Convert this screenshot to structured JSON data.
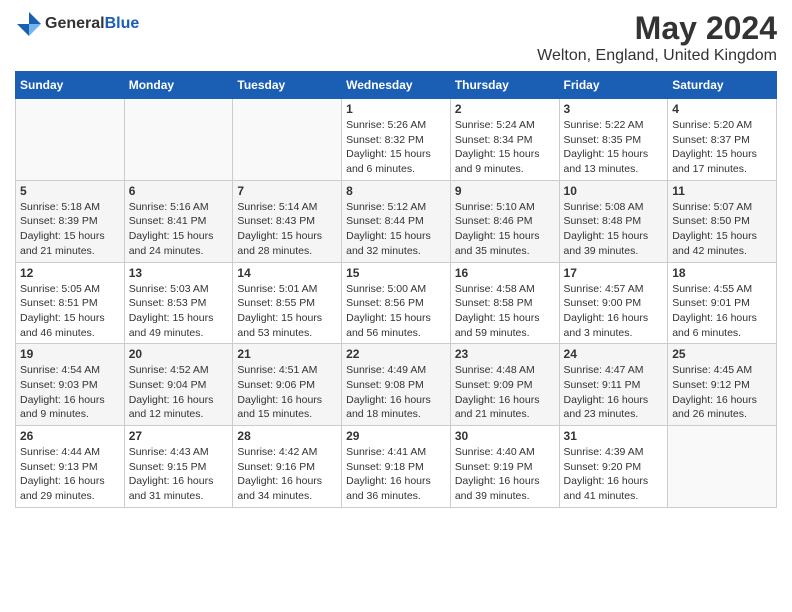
{
  "header": {
    "logo_general": "General",
    "logo_blue": "Blue",
    "month_title": "May 2024",
    "location": "Welton, England, United Kingdom"
  },
  "days_of_week": [
    "Sunday",
    "Monday",
    "Tuesday",
    "Wednesday",
    "Thursday",
    "Friday",
    "Saturday"
  ],
  "weeks": [
    [
      {
        "day": "",
        "info": ""
      },
      {
        "day": "",
        "info": ""
      },
      {
        "day": "",
        "info": ""
      },
      {
        "day": "1",
        "info": "Sunrise: 5:26 AM\nSunset: 8:32 PM\nDaylight: 15 hours\nand 6 minutes."
      },
      {
        "day": "2",
        "info": "Sunrise: 5:24 AM\nSunset: 8:34 PM\nDaylight: 15 hours\nand 9 minutes."
      },
      {
        "day": "3",
        "info": "Sunrise: 5:22 AM\nSunset: 8:35 PM\nDaylight: 15 hours\nand 13 minutes."
      },
      {
        "day": "4",
        "info": "Sunrise: 5:20 AM\nSunset: 8:37 PM\nDaylight: 15 hours\nand 17 minutes."
      }
    ],
    [
      {
        "day": "5",
        "info": "Sunrise: 5:18 AM\nSunset: 8:39 PM\nDaylight: 15 hours\nand 21 minutes."
      },
      {
        "day": "6",
        "info": "Sunrise: 5:16 AM\nSunset: 8:41 PM\nDaylight: 15 hours\nand 24 minutes."
      },
      {
        "day": "7",
        "info": "Sunrise: 5:14 AM\nSunset: 8:43 PM\nDaylight: 15 hours\nand 28 minutes."
      },
      {
        "day": "8",
        "info": "Sunrise: 5:12 AM\nSunset: 8:44 PM\nDaylight: 15 hours\nand 32 minutes."
      },
      {
        "day": "9",
        "info": "Sunrise: 5:10 AM\nSunset: 8:46 PM\nDaylight: 15 hours\nand 35 minutes."
      },
      {
        "day": "10",
        "info": "Sunrise: 5:08 AM\nSunset: 8:48 PM\nDaylight: 15 hours\nand 39 minutes."
      },
      {
        "day": "11",
        "info": "Sunrise: 5:07 AM\nSunset: 8:50 PM\nDaylight: 15 hours\nand 42 minutes."
      }
    ],
    [
      {
        "day": "12",
        "info": "Sunrise: 5:05 AM\nSunset: 8:51 PM\nDaylight: 15 hours\nand 46 minutes."
      },
      {
        "day": "13",
        "info": "Sunrise: 5:03 AM\nSunset: 8:53 PM\nDaylight: 15 hours\nand 49 minutes."
      },
      {
        "day": "14",
        "info": "Sunrise: 5:01 AM\nSunset: 8:55 PM\nDaylight: 15 hours\nand 53 minutes."
      },
      {
        "day": "15",
        "info": "Sunrise: 5:00 AM\nSunset: 8:56 PM\nDaylight: 15 hours\nand 56 minutes."
      },
      {
        "day": "16",
        "info": "Sunrise: 4:58 AM\nSunset: 8:58 PM\nDaylight: 15 hours\nand 59 minutes."
      },
      {
        "day": "17",
        "info": "Sunrise: 4:57 AM\nSunset: 9:00 PM\nDaylight: 16 hours\nand 3 minutes."
      },
      {
        "day": "18",
        "info": "Sunrise: 4:55 AM\nSunset: 9:01 PM\nDaylight: 16 hours\nand 6 minutes."
      }
    ],
    [
      {
        "day": "19",
        "info": "Sunrise: 4:54 AM\nSunset: 9:03 PM\nDaylight: 16 hours\nand 9 minutes."
      },
      {
        "day": "20",
        "info": "Sunrise: 4:52 AM\nSunset: 9:04 PM\nDaylight: 16 hours\nand 12 minutes."
      },
      {
        "day": "21",
        "info": "Sunrise: 4:51 AM\nSunset: 9:06 PM\nDaylight: 16 hours\nand 15 minutes."
      },
      {
        "day": "22",
        "info": "Sunrise: 4:49 AM\nSunset: 9:08 PM\nDaylight: 16 hours\nand 18 minutes."
      },
      {
        "day": "23",
        "info": "Sunrise: 4:48 AM\nSunset: 9:09 PM\nDaylight: 16 hours\nand 21 minutes."
      },
      {
        "day": "24",
        "info": "Sunrise: 4:47 AM\nSunset: 9:11 PM\nDaylight: 16 hours\nand 23 minutes."
      },
      {
        "day": "25",
        "info": "Sunrise: 4:45 AM\nSunset: 9:12 PM\nDaylight: 16 hours\nand 26 minutes."
      }
    ],
    [
      {
        "day": "26",
        "info": "Sunrise: 4:44 AM\nSunset: 9:13 PM\nDaylight: 16 hours\nand 29 minutes."
      },
      {
        "day": "27",
        "info": "Sunrise: 4:43 AM\nSunset: 9:15 PM\nDaylight: 16 hours\nand 31 minutes."
      },
      {
        "day": "28",
        "info": "Sunrise: 4:42 AM\nSunset: 9:16 PM\nDaylight: 16 hours\nand 34 minutes."
      },
      {
        "day": "29",
        "info": "Sunrise: 4:41 AM\nSunset: 9:18 PM\nDaylight: 16 hours\nand 36 minutes."
      },
      {
        "day": "30",
        "info": "Sunrise: 4:40 AM\nSunset: 9:19 PM\nDaylight: 16 hours\nand 39 minutes."
      },
      {
        "day": "31",
        "info": "Sunrise: 4:39 AM\nSunset: 9:20 PM\nDaylight: 16 hours\nand 41 minutes."
      },
      {
        "day": "",
        "info": ""
      }
    ]
  ]
}
